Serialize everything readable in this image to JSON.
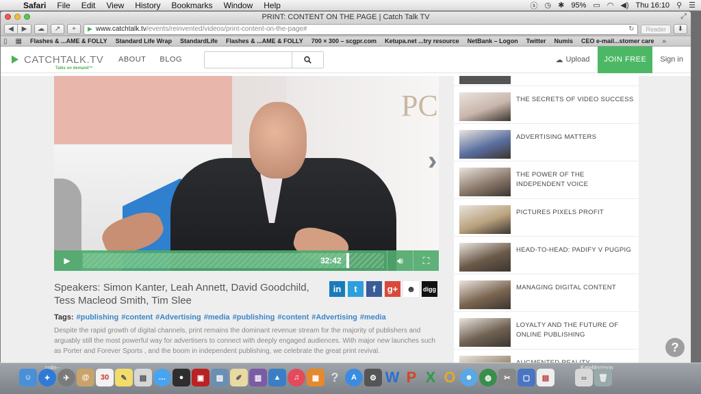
{
  "menubar": {
    "app": "Safari",
    "items": [
      "File",
      "Edit",
      "View",
      "History",
      "Bookmarks",
      "Window",
      "Help"
    ],
    "battery": "95%",
    "clock": "Thu 16:10"
  },
  "browser": {
    "window_title": "PRINT: CONTENT ON THE PAGE | Catch Talk TV",
    "url_host": "www.catchtalk.tv",
    "url_path": "/events/reinvented/videos/print-content-on-the-page#",
    "reader": "Reader",
    "bookmarks": [
      "Flashes & ...AME & FOLLY",
      "Standard Life Wrap",
      "StandardLife",
      "Flashes & ...AME & FOLLY",
      "700 × 300 – scgpr.com",
      "Ketupa.net ...try resource",
      "NetBank – Logon",
      "Twitter",
      "Numis",
      "CEO e-mail...stomer care"
    ]
  },
  "site": {
    "logo": "CATCHTALK.TV",
    "tagline": "Talks on demand™",
    "nav": [
      "ABOUT",
      "BLOG"
    ],
    "upload": "Upload",
    "join": "JOIN FREE",
    "signin": "Sign in"
  },
  "video": {
    "time": "32:42",
    "progress": 0.88,
    "bg_text": "PC"
  },
  "speakers": "Speakers: Simon Kanter, Leah Annett, David Goodchild, Tess Macleod Smith, Tim Slee",
  "share": [
    {
      "name": "linkedin",
      "glyph": "in",
      "color": "#1a7bb9"
    },
    {
      "name": "twitter",
      "glyph": "t",
      "color": "#2d9fdd"
    },
    {
      "name": "facebook",
      "glyph": "f",
      "color": "#3b5b98"
    },
    {
      "name": "google-plus",
      "glyph": "g+",
      "color": "#d9493b"
    },
    {
      "name": "reddit",
      "glyph": "☻",
      "color": "#ffffff"
    },
    {
      "name": "digg",
      "glyph": "digg",
      "color": "#111111"
    }
  ],
  "tags_label": "Tags:",
  "tags": [
    "#publishing",
    "#content",
    "#Advertising",
    "#media",
    "#publishing",
    "#content",
    "#Advertising",
    "#media"
  ],
  "description": "Despite the rapid growth of digital channels, print remains the dominant revenue stream for the majority of publishers and arguably still the most powerful way for advertisers to connect with deeply engaged audiences. With major new launches such as Porter and Forever Sports , and the boom in independent publishing, we celebrate the great print revival.",
  "sidebar": [
    {
      "title": "THE SECRETS OF VIDEO SUCCESS",
      "thumb": "#c9b6ac"
    },
    {
      "title": "ADVERTISING MATTERS",
      "thumb": "#5a6fa0"
    },
    {
      "title": "THE POWER OF THE INDEPENDENT VOICE",
      "thumb": "#8c7a6c"
    },
    {
      "title": "PICTURES PIXELS PROFIT",
      "thumb": "#b9a27d"
    },
    {
      "title": "HEAD-TO-HEAD: PADIFY V PUGPIG",
      "thumb": "#6b5a48"
    },
    {
      "title": "MANAGING DIGITAL CONTENT",
      "thumb": "#7b6550"
    },
    {
      "title": "LOYALTY AND THE FUTURE OF ONLINE PUBLISHING",
      "thumb": "#6f6252"
    },
    {
      "title": "AUGMENTED REALITY",
      "thumb": "#9a8a70"
    }
  ],
  "dock": {
    "left_label": "colin–",
    "right_label": "KateMorrison",
    "calendar_day": "30"
  }
}
